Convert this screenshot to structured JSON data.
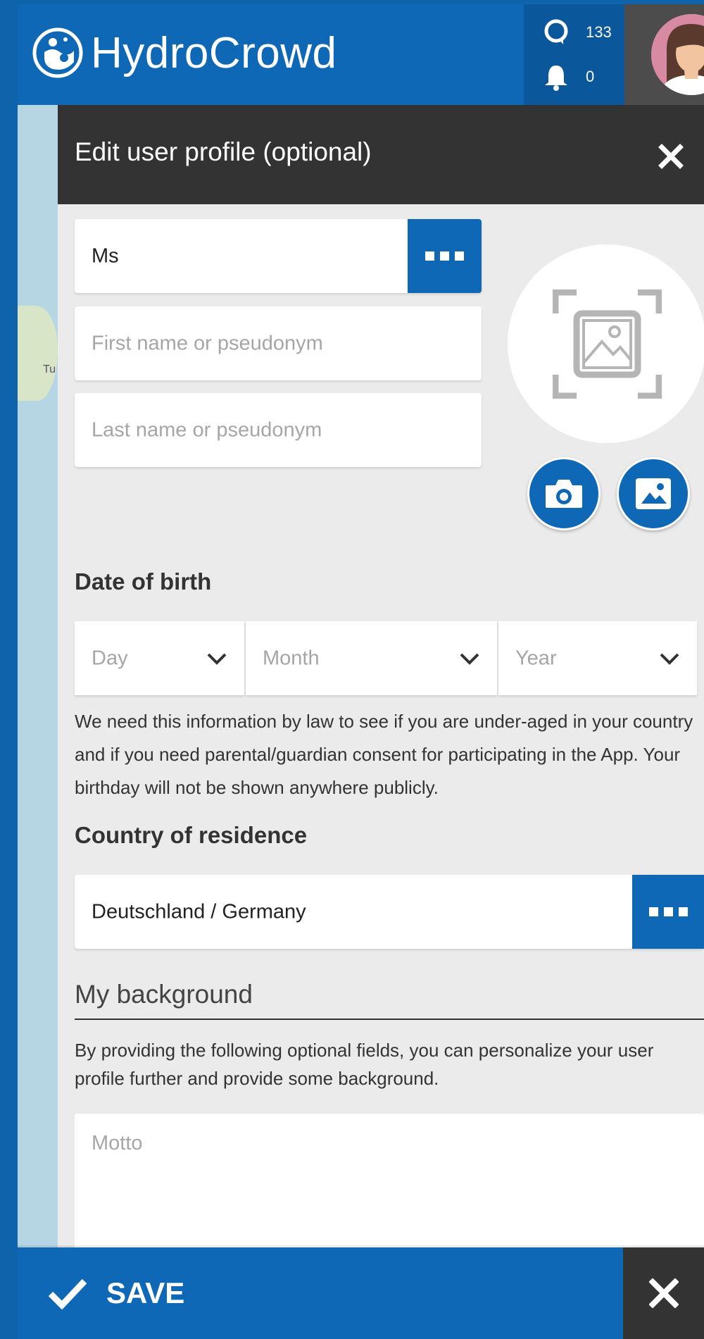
{
  "app": {
    "name": "HydroCrowd"
  },
  "header": {
    "stats": [
      {
        "icon": "speech-bubble-icon",
        "value": "133"
      },
      {
        "icon": "bell-icon",
        "value": "0"
      }
    ],
    "avatar_icon": "user-avatar"
  },
  "map": {
    "label": "Tu"
  },
  "panel": {
    "title": "Edit user profile (optional)",
    "close_icon": "close-icon"
  },
  "form": {
    "salutation": {
      "value": "Ms"
    },
    "first_name": {
      "placeholder": "First name or pseudonym"
    },
    "last_name": {
      "placeholder": "Last name or pseudonym"
    },
    "photo": {
      "placeholder_icon": "image-placeholder-icon",
      "camera_icon": "camera-icon",
      "gallery_icon": "gallery-icon"
    },
    "dob": {
      "heading": "Date of birth",
      "day": "Day",
      "month": "Month",
      "year": "Year",
      "note": "We need this information by law to see if you are under-aged in your country and if you need parental/guardian consent for participating in the App. Your birthday will not be shown anywhere publicly."
    },
    "country": {
      "heading": "Country of residence",
      "value": "Deutschland / Germany"
    },
    "background": {
      "title": "My background",
      "description": "By providing the following optional fields, you can personalize your user profile further and provide some background.",
      "motto_placeholder": "Motto"
    }
  },
  "footer": {
    "save_label": "SAVE",
    "close_icon": "close-icon"
  },
  "colors": {
    "brand_blue": "#0f68b5",
    "dark": "#333333",
    "panel_bg": "#ebebeb"
  }
}
